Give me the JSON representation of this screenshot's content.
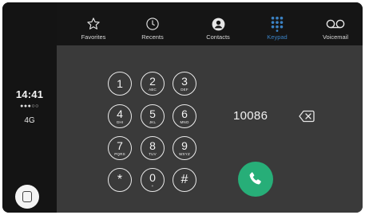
{
  "status": {
    "time": "14:41",
    "signal": "●●●○○",
    "network": "4G"
  },
  "tabs": [
    {
      "label": "Favorites",
      "icon": "star-icon",
      "active": false
    },
    {
      "label": "Recents",
      "icon": "clock-icon",
      "active": false
    },
    {
      "label": "Contacts",
      "icon": "contacts-icon",
      "active": false
    },
    {
      "label": "Keypad",
      "icon": "keypad-icon",
      "active": true
    },
    {
      "label": "Voicemail",
      "icon": "voicemail-icon",
      "active": false
    }
  ],
  "keypad": {
    "k1": {
      "digit": "1",
      "letters": ""
    },
    "k2": {
      "digit": "2",
      "letters": "ABC"
    },
    "k3": {
      "digit": "3",
      "letters": "DEF"
    },
    "k4": {
      "digit": "4",
      "letters": "GHI"
    },
    "k5": {
      "digit": "5",
      "letters": "JKL"
    },
    "k6": {
      "digit": "6",
      "letters": "MNO"
    },
    "k7": {
      "digit": "7",
      "letters": "PQRS"
    },
    "k8": {
      "digit": "8",
      "letters": "TUV"
    },
    "k9": {
      "digit": "9",
      "letters": "WXYZ"
    },
    "star": {
      "digit": "*"
    },
    "k0": {
      "digit": "0",
      "letters": "+"
    },
    "hash": {
      "digit": "#"
    }
  },
  "dialer": {
    "number": "10086"
  },
  "colors": {
    "accent": "#3b82c4",
    "call_green": "#27ae78",
    "background": "#3a3a3a",
    "bar": "#151515"
  }
}
